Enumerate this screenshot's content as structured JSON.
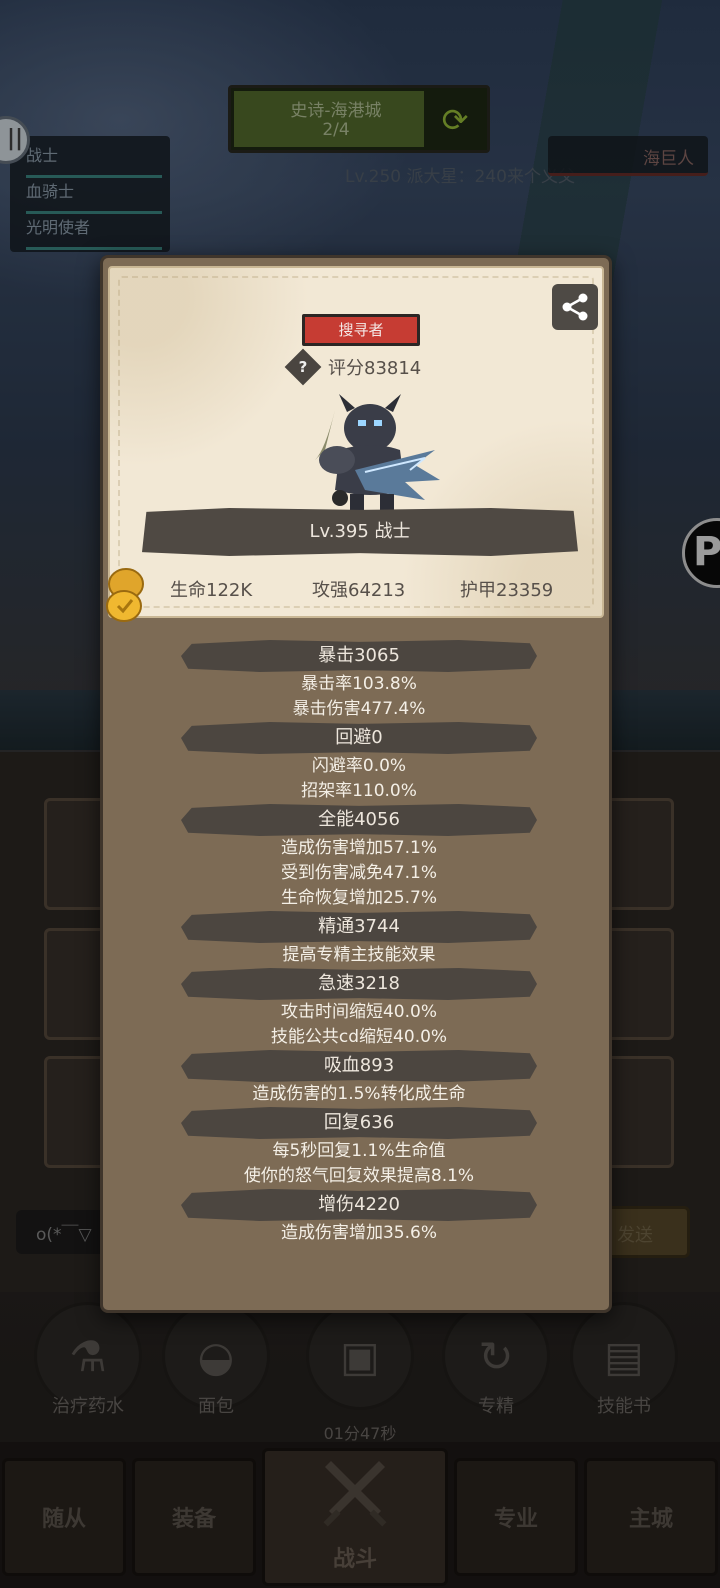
{
  "stage": {
    "title": "史诗-海港城",
    "progress": "2/4"
  },
  "level_line": "Lv.250 派大星：240来个义父",
  "party": [
    "战士",
    "血骑士",
    "光明使者"
  ],
  "enemy": "海巨人",
  "hero": {
    "role_badge": "搜寻者",
    "score": "评分83814",
    "name": "Lv.395 战士",
    "hp": "生命122K",
    "attack": "攻强64213",
    "armor": "护甲23359"
  },
  "sections": [
    {
      "title": "暴击3065",
      "lines": [
        "暴击率103.8%",
        "暴击伤害477.4%"
      ]
    },
    {
      "title": "回避0",
      "lines": [
        "闪避率0.0%",
        "招架率110.0%"
      ]
    },
    {
      "title": "全能4056",
      "lines": [
        "造成伤害增加57.1%",
        "受到伤害减免47.1%",
        "生命恢复增加25.7%"
      ]
    },
    {
      "title": "精通3744",
      "lines": [
        "提高专精主技能效果"
      ]
    },
    {
      "title": "急速3218",
      "lines": [
        "攻击时间缩短40.0%",
        "技能公共cd缩短40.0%"
      ]
    },
    {
      "title": "吸血893",
      "lines": [
        "造成伤害的1.5%转化成生命"
      ]
    },
    {
      "title": "回复636",
      "lines": [
        "每5秒回复1.1%生命值",
        "使你的怒气回复效果提高8.1%"
      ]
    },
    {
      "title": "增伤4220",
      "lines": [
        "造成伤害增加35.6%"
      ]
    }
  ],
  "chat": {
    "input": "o(*￣▽",
    "send": "发送"
  },
  "items": [
    {
      "label": "治疗药水",
      "icon": "potion-icon"
    },
    {
      "label": "面包",
      "icon": "bread-icon"
    },
    {
      "label": "",
      "icon": "chest-icon"
    },
    {
      "label": "专精",
      "icon": "specialization-icon"
    },
    {
      "label": "技能书",
      "icon": "skill-book-icon"
    }
  ],
  "timer": "01分47秒",
  "nav": {
    "followers": "随从",
    "equipment": "装备",
    "battle": "战斗",
    "profession": "专业",
    "main_city": "主城"
  },
  "colors": {
    "modal_bg": "#7d6b55",
    "card_bg": "#f2e8d5",
    "badge_red": "#c63c33",
    "header_dark": "#4c4640"
  }
}
